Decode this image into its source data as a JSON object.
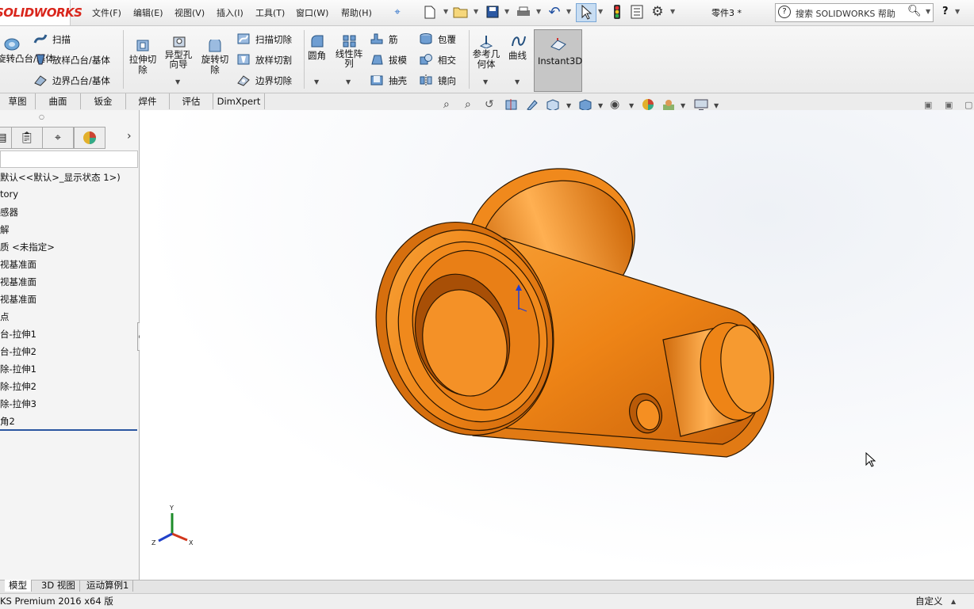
{
  "app": {
    "logo_text": "SOLIDWORKS",
    "document_title": "零件3 *"
  },
  "menu": [
    "文件(F)",
    "编辑(E)",
    "视图(V)",
    "插入(I)",
    "工具(T)",
    "窗口(W)",
    "帮助(H)"
  ],
  "search": {
    "placeholder": "搜索 SOLIDWORKS 帮助"
  },
  "help_glyph": "?",
  "commands": {
    "revolve_boss": "旋转凸台/基体",
    "sweep": "扫描",
    "loft_boss": "放样凸台/基体",
    "boundary_boss": "边界凸台/基体",
    "extrude_cut": "拉伸切除",
    "hole_wizard": "异型孔向导",
    "revolve_cut": "旋转切除",
    "swept_cut": "扫描切除",
    "lofted_cut": "放样切割",
    "boundary_cut": "边界切除",
    "fillet": "圆角",
    "linear_pattern": "线性阵列",
    "rib": "筋",
    "draft": "拔模",
    "shell": "抽壳",
    "wrap": "包覆",
    "intersect": "相交",
    "mirror": "镜向",
    "ref_geometry": "参考几何体",
    "curves": "曲线",
    "instant3d": "Instant3D"
  },
  "tabs": [
    "草图",
    "曲面",
    "钣金",
    "焊件",
    "评估",
    "DimXpert"
  ],
  "feature_tree": [
    "默认<<默认>_显示状态 1>)",
    "tory",
    "感器",
    "解",
    "质 <未指定>",
    "视基准面",
    "视基准面",
    "视基准面",
    "点",
    "台-拉伸1",
    "台-拉伸2",
    "除-拉伸1",
    "除-拉伸2",
    "除-拉伸3",
    "角2"
  ],
  "triad": {
    "x": "X",
    "y": "Y",
    "z": "Z"
  },
  "bottom_tabs": [
    "模型",
    "3D 视图",
    "运动算例1"
  ],
  "status": {
    "left": "KS Premium 2016 x64 版",
    "right": "自定义"
  },
  "colors": {
    "part_orange": "#f08a1c",
    "select_blue": "#2a56a0"
  }
}
